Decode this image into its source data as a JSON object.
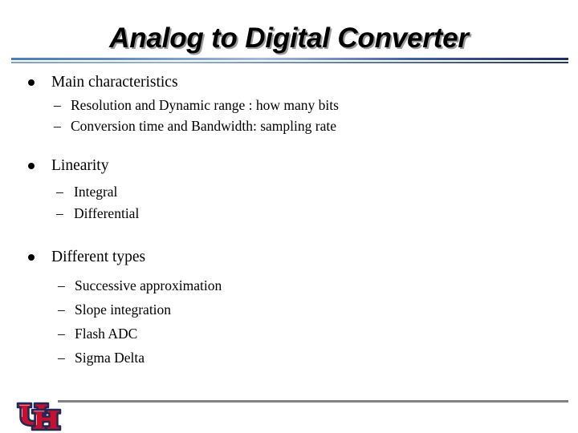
{
  "slide": {
    "title": "Analog to Digital Converter",
    "background_color": "#ffffff",
    "text_color": "#000000",
    "rule_colors": {
      "title_rule_left": "#4d7ebf",
      "title_rule_right": "#1c2d63",
      "footer_rule": "#808285"
    },
    "groups": [
      {
        "heading": "Main characteristics",
        "bullet_glyph": "•",
        "sub_bullet_glyph": "–",
        "items": [
          "Resolution and Dynamic range : how many bits",
          "Conversion time and Bandwidth: sampling rate"
        ]
      },
      {
        "heading": "Linearity",
        "bullet_glyph": "•",
        "sub_bullet_glyph": "–",
        "items": [
          "Integral",
          "Differential"
        ]
      },
      {
        "heading": "Different types",
        "bullet_glyph": "•",
        "sub_bullet_glyph": "–",
        "items": [
          "Successive approximation",
          "Slope integration",
          "Flash ADC",
          "Sigma Delta"
        ]
      }
    ]
  },
  "footer": {
    "logo_name": "university-of-houston-uh-logo",
    "logo_letters": "UH",
    "logo_fill": "#c8102e",
    "logo_outline": "#1d2a57"
  }
}
